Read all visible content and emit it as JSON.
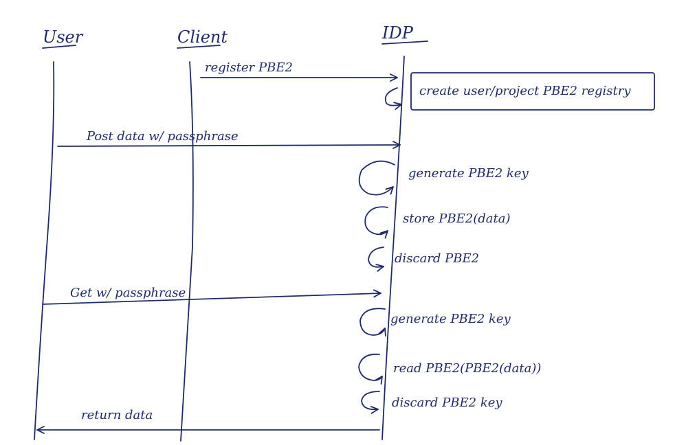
{
  "participants": [
    {
      "name": "User"
    },
    {
      "name": "Client"
    },
    {
      "name": "IDP"
    }
  ],
  "messages": [
    {
      "label": "register PBE2",
      "from": "Client",
      "to": "IDP"
    },
    {
      "label": "Post data w/ passphrase",
      "from": "User",
      "to": "IDP"
    },
    {
      "label": "Get w/ passphrase",
      "from": "User",
      "to": "IDP"
    },
    {
      "label": "return data",
      "from": "IDP",
      "to": "User"
    }
  ],
  "self_steps": [
    {
      "label": "create user/project PBE2 registry",
      "boxed": true
    },
    {
      "label": "generate PBE2 key"
    },
    {
      "label": "store PBE2(data)"
    },
    {
      "label": "discard PBE2"
    },
    {
      "label": "generate PBE2 key"
    },
    {
      "label": "read PBE2(PBE2(data))"
    },
    {
      "label": "discard PBE2 key"
    }
  ]
}
